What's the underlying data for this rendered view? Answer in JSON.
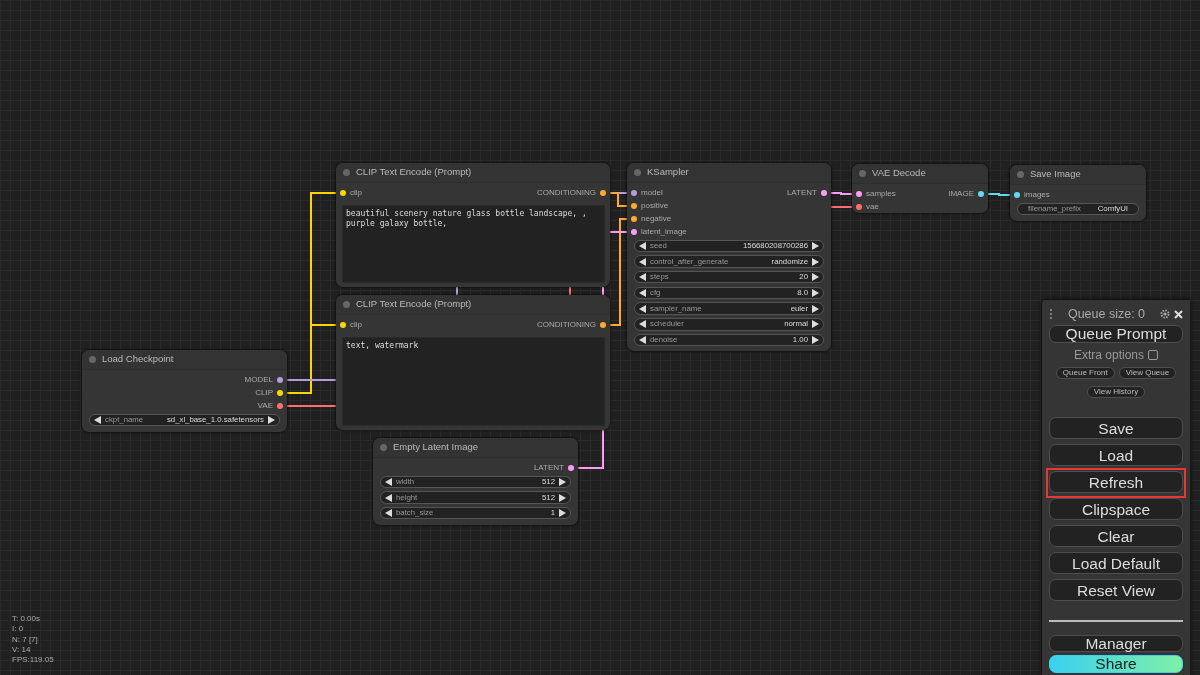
{
  "canvas": {
    "nodes": [
      {
        "title": "CLIP Text Encode (Prompt)",
        "inputs": [
          {
            "label": "clip",
            "color": "#ffd500"
          }
        ],
        "outputs": [
          {
            "label": "CONDITIONING",
            "color": "#ffa931"
          }
        ],
        "text": "beautiful scenery nature glass bottle landscape, , purple galaxy bottle,"
      },
      {
        "title": "KSampler",
        "inputs": [
          {
            "label": "model",
            "color": "#b39ddb"
          },
          {
            "label": "positive",
            "color": "#ffa931"
          },
          {
            "label": "negative",
            "color": "#ffa931"
          },
          {
            "label": "latent_image",
            "color": "#ff9cf9"
          }
        ],
        "outputs": [
          {
            "label": "LATENT",
            "color": "#ff9cf9"
          }
        ],
        "widgets": [
          {
            "kind": "number",
            "label": "seed",
            "value": "156680208700286"
          },
          {
            "kind": "combo",
            "label": "control_after_generate",
            "value": "randomize"
          },
          {
            "kind": "number",
            "label": "steps",
            "value": "20"
          },
          {
            "kind": "number",
            "label": "cfg",
            "value": "8.0"
          },
          {
            "kind": "combo",
            "label": "sampler_name",
            "value": "euler"
          },
          {
            "kind": "combo",
            "label": "scheduler",
            "value": "normal"
          },
          {
            "kind": "number",
            "label": "denoise",
            "value": "1.00"
          }
        ]
      },
      {
        "title": "VAE Decode",
        "inputs": [
          {
            "label": "samples",
            "color": "#ff9cf9"
          },
          {
            "label": "vae",
            "color": "#ff6e6e"
          }
        ],
        "outputs": [
          {
            "label": "IMAGE",
            "color": "#64d8ee"
          }
        ]
      },
      {
        "title": "Save Image",
        "inputs": [
          {
            "label": "images",
            "color": "#64d8ee"
          }
        ],
        "widgets": [
          {
            "kind": "text",
            "label": "filename_prefix",
            "value": "ComfyUI"
          }
        ]
      },
      {
        "title": "CLIP Text Encode (Prompt)",
        "inputs": [
          {
            "label": "clip",
            "color": "#ffd500"
          }
        ],
        "outputs": [
          {
            "label": "CONDITIONING",
            "color": "#ffa931"
          }
        ],
        "text": "text, watermark"
      },
      {
        "title": "Load Checkpoint",
        "outputs": [
          {
            "label": "MODEL",
            "color": "#b39ddb"
          },
          {
            "label": "CLIP",
            "color": "#ffd500"
          },
          {
            "label": "VAE",
            "color": "#ff6e6e"
          }
        ],
        "widgets": [
          {
            "kind": "combo",
            "label": "ckpt_name",
            "value": "sd_xl_base_1.0.safetensors"
          }
        ]
      },
      {
        "title": "Empty Latent Image",
        "outputs": [
          {
            "label": "LATENT",
            "color": "#ff9cf9"
          }
        ],
        "widgets": [
          {
            "kind": "number",
            "label": "width",
            "value": "512"
          },
          {
            "kind": "number",
            "label": "height",
            "value": "512"
          },
          {
            "kind": "number",
            "label": "batch_size",
            "value": "1"
          }
        ]
      }
    ],
    "stats": [
      "T: 0.00s",
      "I: 0",
      "N: 7 [7]",
      "V: 14",
      "FPS:119.05"
    ]
  },
  "queue_panel": {
    "queue_size": "Queue size: 0",
    "queue_prompt": "Queue Prompt",
    "extra_options": {
      "label": "Extra options",
      "checked": false
    },
    "small_buttons": [
      "Queue Front",
      "View Queue",
      "View History"
    ],
    "buttons": [
      {
        "label": "Save",
        "highlighted": false
      },
      {
        "label": "Load",
        "highlighted": false
      },
      {
        "label": "Refresh",
        "highlighted": true
      },
      {
        "label": "Clipspace",
        "highlighted": false
      },
      {
        "label": "Clear",
        "highlighted": false
      },
      {
        "label": "Load Default",
        "highlighted": false
      },
      {
        "label": "Reset View",
        "highlighted": false
      }
    ],
    "bottom_buttons": [
      {
        "label": "Manager",
        "kind": "plain"
      },
      {
        "label": "Share",
        "kind": "gradient"
      }
    ]
  }
}
